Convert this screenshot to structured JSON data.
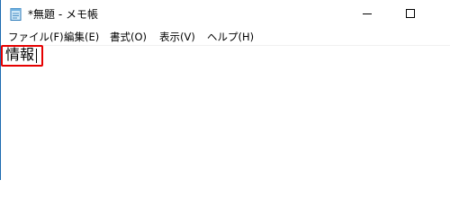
{
  "window": {
    "title": "*無題 - メモ帳",
    "app_icon": "notepad-icon"
  },
  "controls": {
    "minimize_icon": "minimize-icon",
    "maximize_icon": "maximize-icon"
  },
  "menu": {
    "items": [
      {
        "label": "ファイル(F)"
      },
      {
        "label": "編集(E)"
      },
      {
        "label": "書式(O)"
      },
      {
        "label": "表示(V)"
      },
      {
        "label": "ヘルプ(H)"
      }
    ]
  },
  "editor": {
    "text": "情報"
  },
  "colors": {
    "highlight": "#e60000",
    "window_border": "#1c6bb0"
  }
}
